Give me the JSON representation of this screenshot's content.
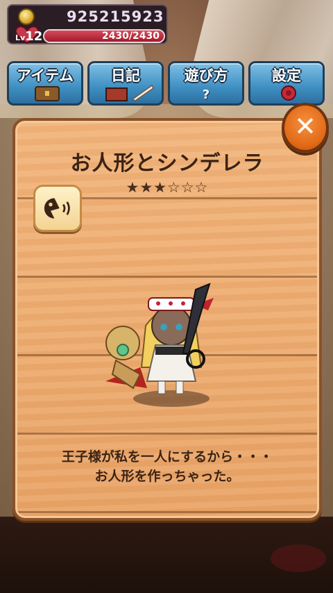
{
  "status": {
    "coins": "925215923",
    "level_prefix": "Lv",
    "level": "12",
    "hp_text": "2430/2430",
    "hp_fraction": 1.0
  },
  "menu": {
    "items": [
      {
        "label": "アイテム"
      },
      {
        "label": "日記"
      },
      {
        "label": "遊び方",
        "sub": "?"
      },
      {
        "label": "設定"
      }
    ]
  },
  "dialog": {
    "title": "お人形とシンデレラ",
    "rating": 3,
    "rating_max": 6,
    "quote_line1": "王子様が私を一人にするから・・・",
    "quote_line2": "お人形を作っちゃった。",
    "close_symbol": "✕"
  },
  "colors": {
    "panel_wood": "#e9a466",
    "menu_blue": "#3f8fc2",
    "close_orange": "#e26a17",
    "hp_red": "#a11a2c"
  }
}
